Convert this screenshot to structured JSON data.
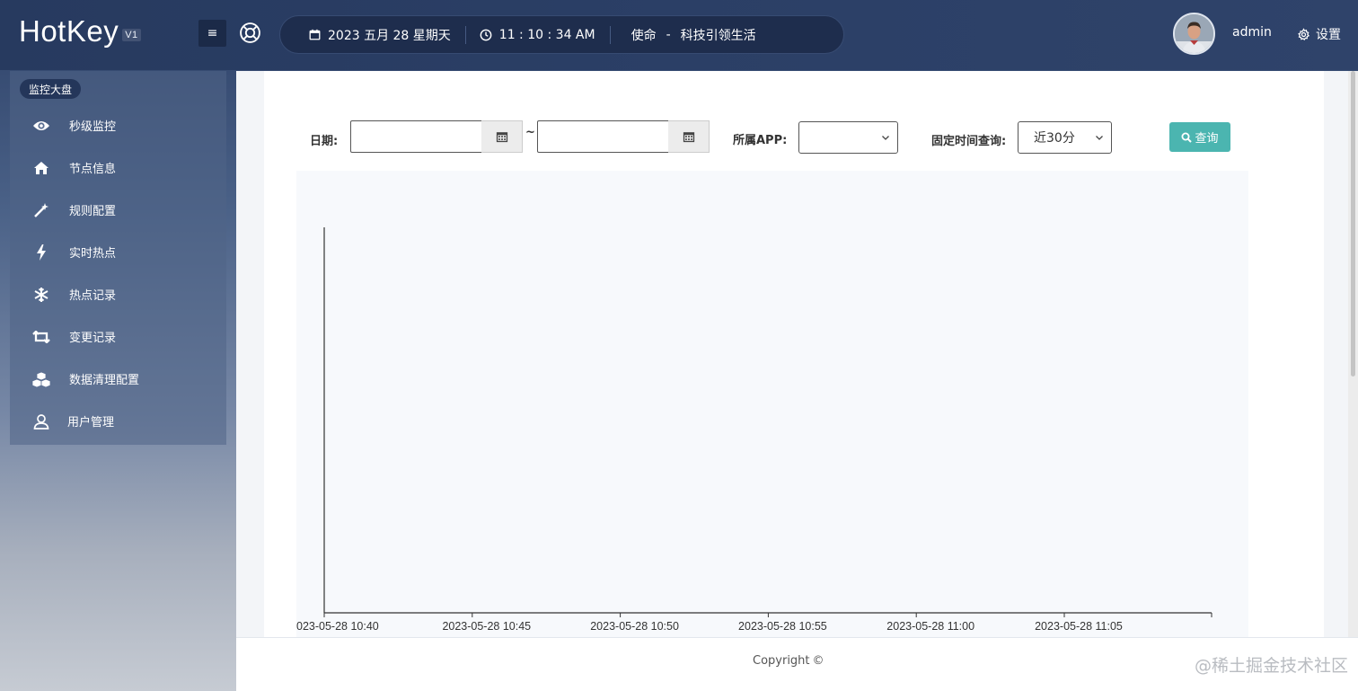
{
  "header": {
    "logo": "HotKey",
    "version": "V1",
    "date": "2023 五月 28 星期天",
    "time": "11 : 10 : 34 AM",
    "motto_label": "使命",
    "motto_dash": "-",
    "motto_text": "科技引领生活",
    "username": "admin",
    "settings_label": "设置"
  },
  "sidebar": {
    "header": "监控大盘",
    "items": [
      {
        "label": "秒级监控",
        "icon": "eye-icon"
      },
      {
        "label": "节点信息",
        "icon": "home-icon"
      },
      {
        "label": "规则配置",
        "icon": "magic-wand-icon"
      },
      {
        "label": "实时热点",
        "icon": "lightning-icon"
      },
      {
        "label": "热点记录",
        "icon": "snowflake-icon"
      },
      {
        "label": "变更记录",
        "icon": "retweet-icon"
      },
      {
        "label": "数据清理配置",
        "icon": "cubes-icon"
      },
      {
        "label": "用户管理",
        "icon": "user-icon"
      }
    ]
  },
  "filters": {
    "date_label": "日期:",
    "start_date": "",
    "tilde": "~",
    "end_date": "",
    "app_label": "所属APP:",
    "app_value": "",
    "fixed_label": "固定时间查询:",
    "fixed_value": "近30分",
    "query_label": "查询"
  },
  "chart_data": {
    "type": "line",
    "x": [
      "023-05-28 10:40",
      "2023-05-28 10:45",
      "2023-05-28 10:50",
      "2023-05-28 10:55",
      "2023-05-28 11:00",
      "2023-05-28 11:05"
    ],
    "series": []
  },
  "footer": {
    "copyright": "Copyright",
    "copyright_symbol": "©",
    "watermark": "@稀土掘金技术社区"
  },
  "colors": {
    "accent": "#4bb5b0",
    "topbar": "#2b3f66"
  }
}
